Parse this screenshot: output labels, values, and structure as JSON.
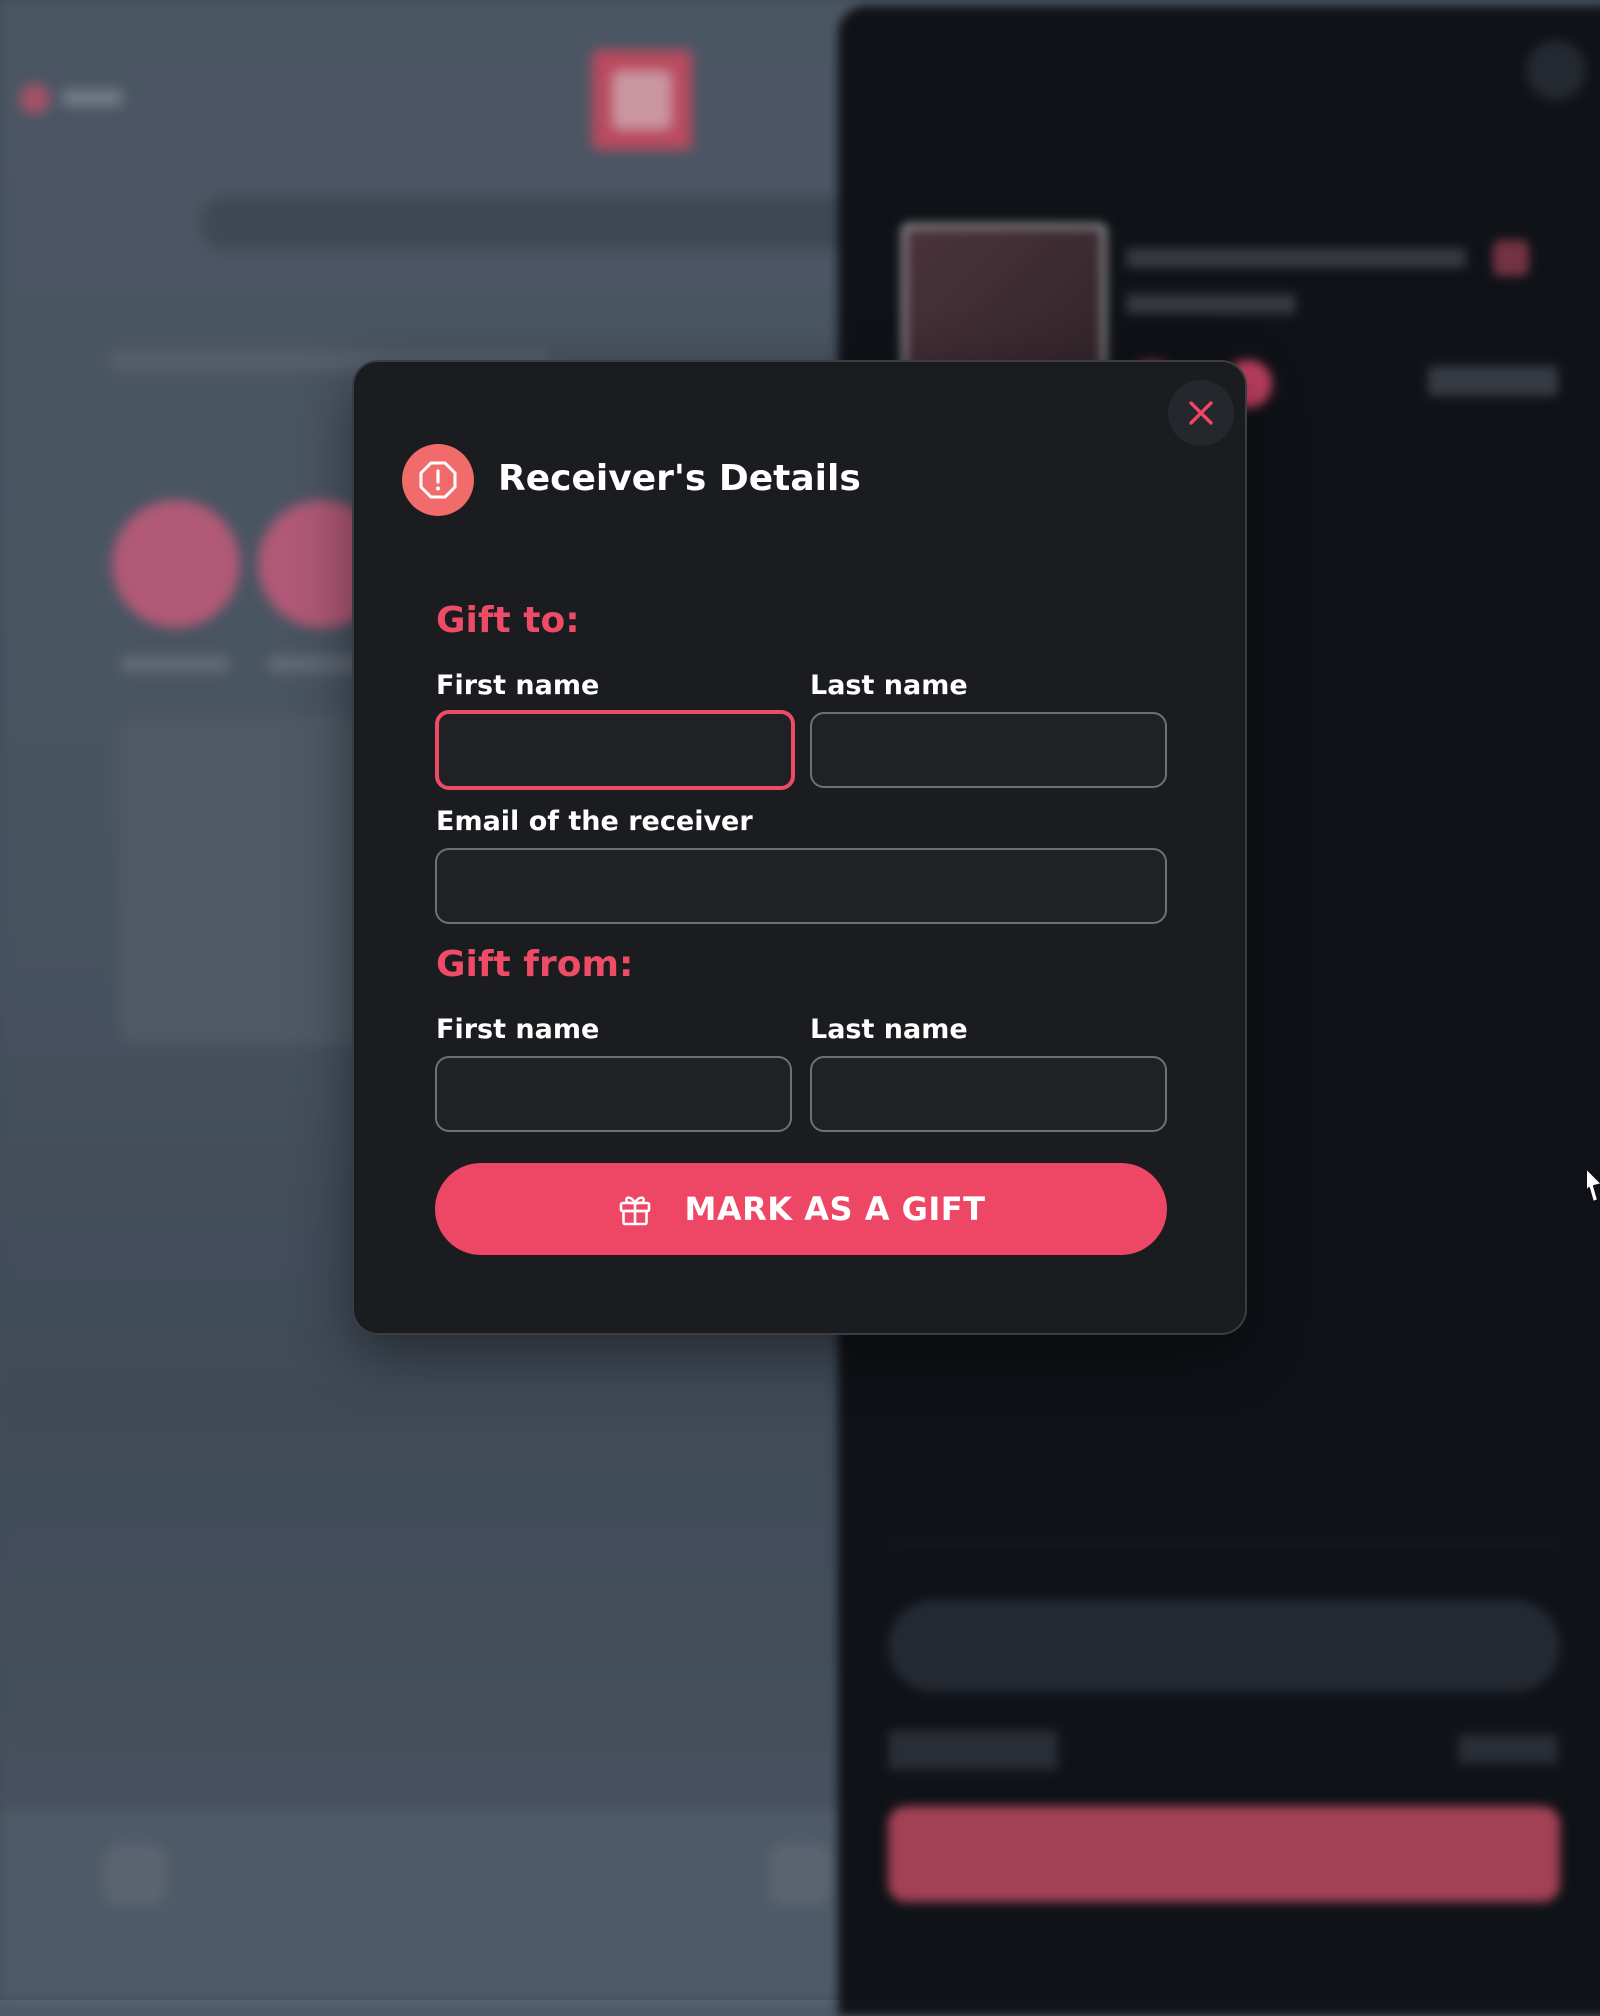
{
  "modal": {
    "title": "Receiver's Details",
    "gift_to_heading": "Gift to:",
    "gift_from_heading": "Gift from:",
    "to_first_name_label": "First name",
    "to_last_name_label": "Last name",
    "email_label": "Email of the receiver",
    "from_first_name_label": "First name",
    "from_last_name_label": "Last name",
    "to_first_name_value": "",
    "to_last_name_value": "",
    "email_value": "",
    "from_first_name_value": "",
    "from_last_name_value": "",
    "submit_label": "MARK AS A GIFT"
  },
  "icons": {
    "header": "alert-octagon-icon",
    "close": "close-icon",
    "submit": "gift-icon"
  },
  "colors": {
    "accent": "#ee4665",
    "modal_bg": "#1b1c20",
    "header_icon_bg": "#f26b6b"
  }
}
